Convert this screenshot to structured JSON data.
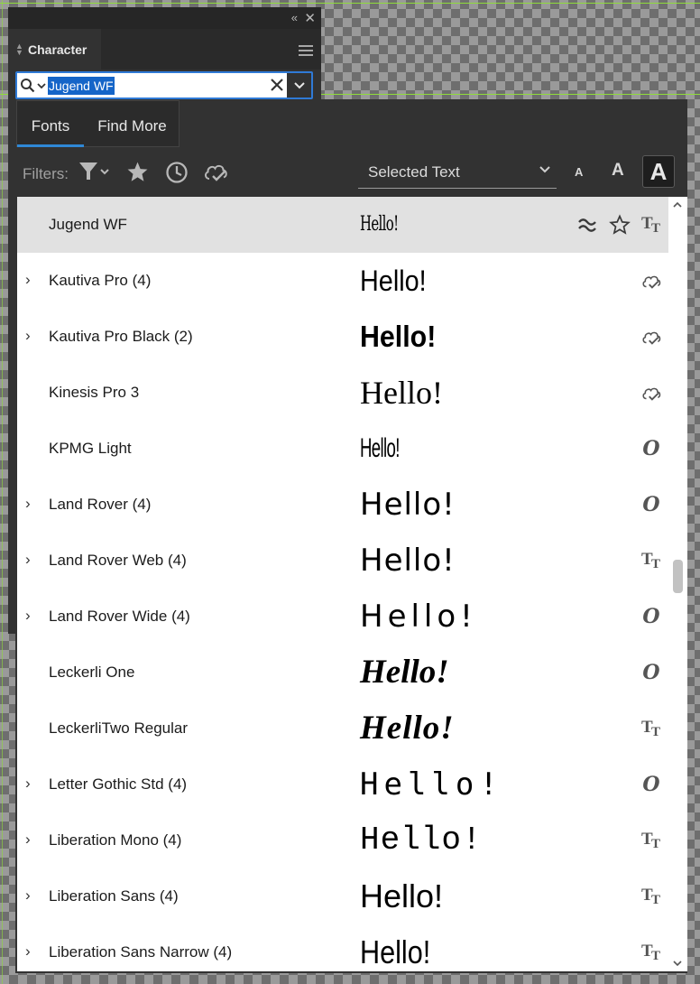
{
  "character_panel": {
    "title": "Character",
    "collapse_icon": "«",
    "close_icon": "✕"
  },
  "search": {
    "value": "Jugend WF"
  },
  "font_panel": {
    "tabs": [
      "Fonts",
      "Find More"
    ],
    "filters_label": "Filters:",
    "preview_label": "Selected Text",
    "size_small": "A",
    "size_medium": "A",
    "size_large": "A",
    "fonts": [
      {
        "name": "Jugend WF",
        "preview": "Hello!",
        "status": "activated",
        "selected": true,
        "expandable": false
      },
      {
        "name": "Kautiva Pro (4)",
        "preview": "Hello!",
        "status": "cloud",
        "expandable": true
      },
      {
        "name": "Kautiva Pro Black (2)",
        "preview": "Hello!",
        "status": "cloud",
        "expandable": true
      },
      {
        "name": "Kinesis Pro 3",
        "preview": "Hello!",
        "status": "cloud",
        "expandable": false
      },
      {
        "name": "KPMG Light",
        "preview": "Hello!",
        "status": "opentype",
        "expandable": false
      },
      {
        "name": "Land Rover (4)",
        "preview": "Hello!",
        "status": "opentype",
        "expandable": true
      },
      {
        "name": "Land Rover Web (4)",
        "preview": "Hello!",
        "status": "truetype",
        "expandable": true
      },
      {
        "name": "Land Rover Wide (4)",
        "preview": "Hello!",
        "status": "opentype",
        "expandable": true
      },
      {
        "name": "Leckerli One",
        "preview": "Hello!",
        "status": "opentype",
        "expandable": false
      },
      {
        "name": "LeckerliTwo Regular",
        "preview": "Hello!",
        "status": "truetype",
        "expandable": false
      },
      {
        "name": "Letter Gothic Std (4)",
        "preview": "Hello!",
        "status": "opentype",
        "expandable": true
      },
      {
        "name": "Liberation Mono (4)",
        "preview": "Hello!",
        "status": "truetype",
        "expandable": true
      },
      {
        "name": "Liberation Sans (4)",
        "preview": "Hello!",
        "status": "truetype",
        "expandable": true
      },
      {
        "name": "Liberation Sans Narrow (4)",
        "preview": "Hello!",
        "status": "truetype",
        "expandable": true
      }
    ],
    "icons": {
      "filter": "filter-icon",
      "favorites": "star-icon",
      "recent": "clock-icon",
      "activated": "cloud-check-icon",
      "similar": "similar-fonts-icon",
      "favorite_row": "star-outline-icon"
    }
  }
}
